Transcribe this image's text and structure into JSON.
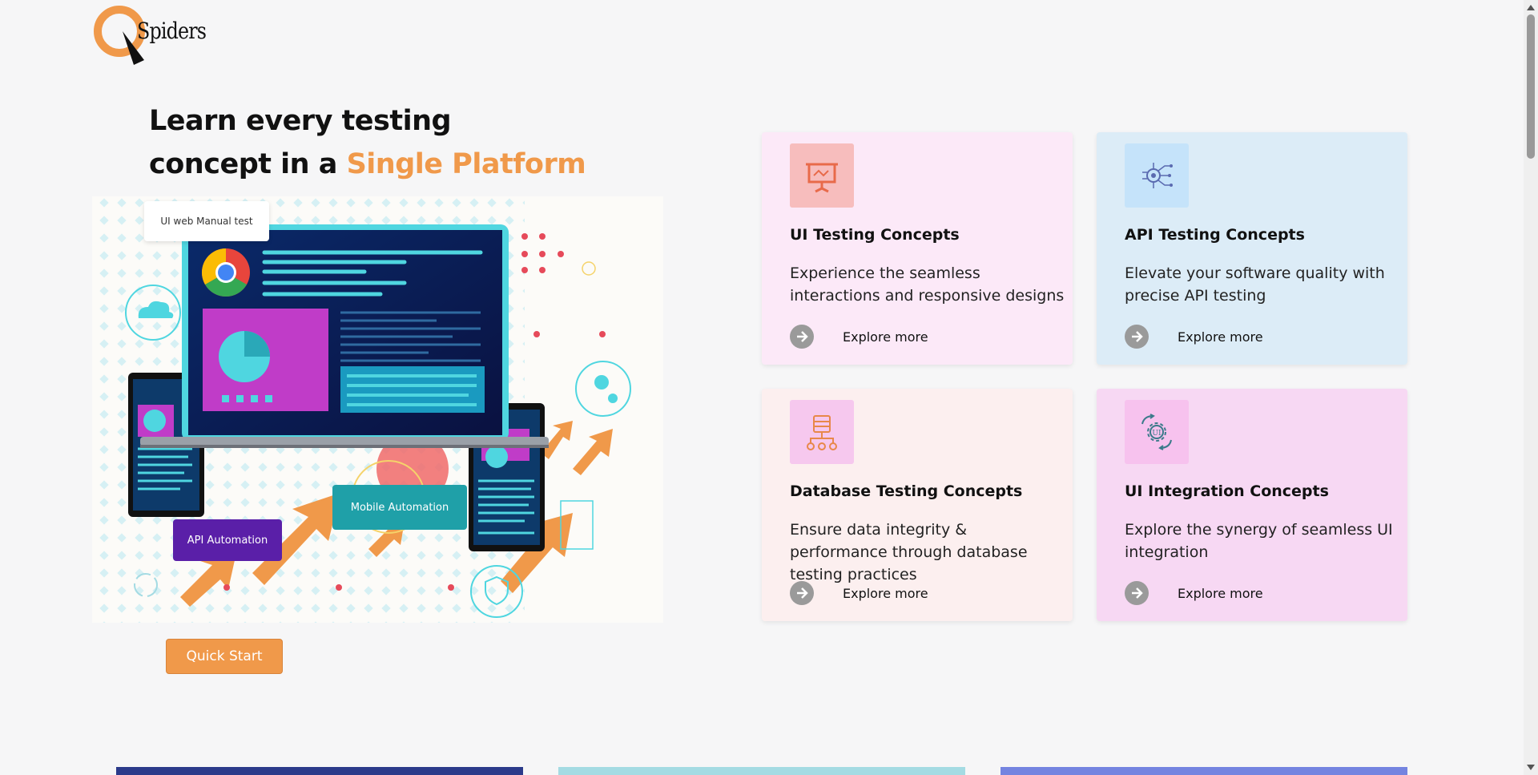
{
  "brand": {
    "name": "Spiders"
  },
  "headline": {
    "line1": "Learn every testing",
    "line2_prefix": "concept in a ",
    "line2_accent": "Single Platform"
  },
  "hero": {
    "tag_manual": "UI web Manual test",
    "tag_mobile": "Mobile Automation",
    "tag_api": "API Automation"
  },
  "quick_start_label": "Quick Start",
  "cards": [
    {
      "title": "UI Testing Concepts",
      "desc": "Experience the seamless interactions and responsive designs",
      "explore": "Explore more",
      "bg": "#fce9f8",
      "icon_bg": "#f7bdbd",
      "icon": "presentation-board-icon"
    },
    {
      "title": "API Testing Concepts",
      "desc": "Elevate your software quality with precise API testing",
      "explore": "Explore more",
      "bg": "#dcecf7",
      "icon_bg": "#c5e3fa",
      "icon": "api-network-icon"
    },
    {
      "title": "Database Testing Concepts",
      "desc": "Ensure data integrity & performance through database testing practices",
      "explore": "Explore more",
      "bg": "#fcefef",
      "icon_bg": "#f6c8ee",
      "icon": "database-hierarchy-icon"
    },
    {
      "title": "UI Integration Concepts",
      "desc": "Explore the synergy of seamless UI integration",
      "explore": "Explore more",
      "bg": "#f7d8f3",
      "icon_bg": "#f7c2ee",
      "icon": "ui-gear-sync-icon"
    }
  ],
  "colors": {
    "accent": "#f0994a",
    "strip1": "#2b3a8a",
    "strip2": "#a4dbe3",
    "strip3": "#7484e0"
  }
}
